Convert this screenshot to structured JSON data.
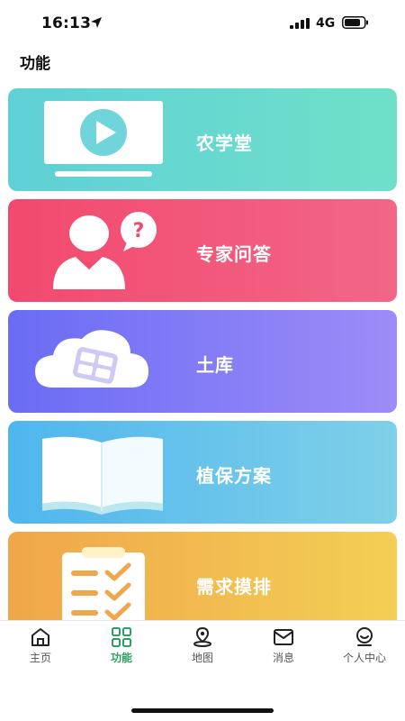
{
  "status": {
    "time": "16:13",
    "network": "4G"
  },
  "page": {
    "title": "功能"
  },
  "cards": [
    {
      "label": "农学堂",
      "icon": "video-lesson-icon"
    },
    {
      "label": "专家问答",
      "icon": "expert-question-icon"
    },
    {
      "label": "土库",
      "icon": "cloud-database-icon"
    },
    {
      "label": "植保方案",
      "icon": "open-book-icon"
    },
    {
      "label": "需求摸排",
      "icon": "checklist-clipboard-icon"
    }
  ],
  "tabs": [
    {
      "label": "主页",
      "icon": "home-icon"
    },
    {
      "label": "功能",
      "icon": "grid-icon",
      "active": true
    },
    {
      "label": "地图",
      "icon": "map-pin-icon"
    },
    {
      "label": "消息",
      "icon": "mail-icon"
    },
    {
      "label": "个人中心",
      "icon": "profile-icon"
    }
  ],
  "colors": {
    "active_tab": "#2f9e62"
  }
}
